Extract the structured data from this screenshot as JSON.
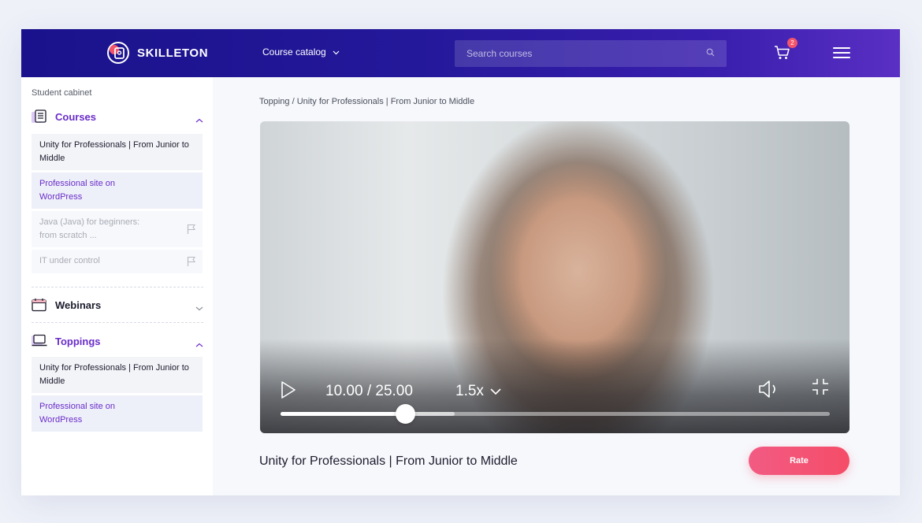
{
  "header": {
    "brand": "SKILLETON",
    "catalog_label": "Course catalog",
    "search": {
      "placeholder": "Search courses",
      "value": ""
    },
    "cart": {
      "count": "2",
      "icon": "cart-icon"
    },
    "menu_icon": "hamburger-icon",
    "colors": {
      "gradient_start": "#1a128c",
      "gradient_end": "#5a2fc4",
      "badge": "#f2556b"
    }
  },
  "sidebar": {
    "label": "Student cabinet",
    "sections": [
      {
        "title": "Courses",
        "icon": "courses-icon",
        "expanded": true,
        "items": [
          {
            "label": "Unity for Professionals | From Junior to Middle",
            "state": "normal"
          },
          {
            "label": "Professional site on WordPress",
            "state": "active"
          },
          {
            "label": "Java (Java) for beginners: from scratch ...",
            "state": "locked",
            "icon": "flag-icon"
          },
          {
            "label": "IT under control",
            "state": "locked",
            "icon": "flag-icon"
          }
        ]
      },
      {
        "title": "Webinars",
        "icon": "calendar-icon",
        "expanded": false,
        "items": []
      },
      {
        "title": "Toppings",
        "icon": "laptop-icon",
        "expanded": true,
        "items": [
          {
            "label": "Unity for Professionals | From Junior to Middle",
            "state": "normal"
          },
          {
            "label": "Professional site on WordPress",
            "state": "active"
          }
        ]
      }
    ]
  },
  "main": {
    "breadcrumb": "Topping / Unity for Professionals | From Junior to Middle",
    "player": {
      "time": "10.00 / 25.00",
      "speed": "1.5x",
      "progress_fraction": 0.227,
      "buffered_fraction": 0.317,
      "icons": [
        "play-icon",
        "volume-icon",
        "exit-fullscreen-icon"
      ]
    },
    "video_title": "Unity for Professionals | From Junior to Middle",
    "rate_label": "Rate",
    "colors": {
      "accent": "#6a2dc9",
      "rate_button": "#f54d68"
    }
  }
}
